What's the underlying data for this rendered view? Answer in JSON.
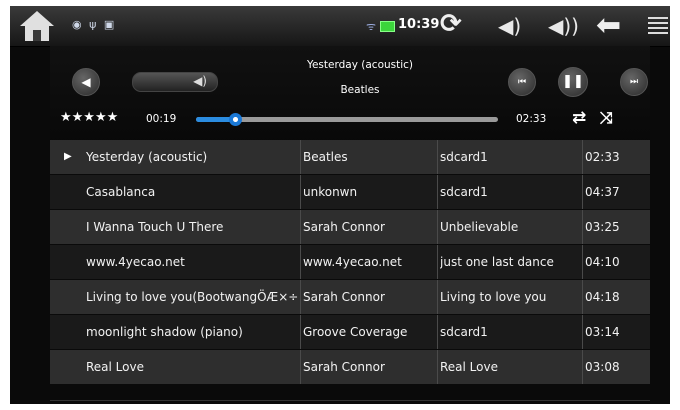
{
  "statusbar": {
    "home_icon": "home-icon",
    "notifications": "◉ ψ ▣",
    "time": "10:39",
    "icons": [
      "refresh-icon",
      "volume-down-icon",
      "volume-up-icon",
      "back-icon",
      "menu-icon"
    ]
  },
  "player": {
    "now_playing_title": "Yesterday (acoustic)",
    "now_playing_artist": "Beatles",
    "elapsed": "00:19",
    "total": "02:33",
    "progress_fraction": 0.13,
    "rating_stars": "★★★★★",
    "icons": [
      "back-arrow-icon",
      "volume-icon",
      "previous-track-icon",
      "pause-icon",
      "next-track-icon",
      "repeat-icon",
      "shuffle-icon"
    ]
  },
  "tracks": [
    {
      "title": "Yesterday (acoustic)",
      "artist": "Beatles",
      "album": "sdcard1",
      "duration": "02:33",
      "playing": true
    },
    {
      "title": "Casablanca",
      "artist": "unkonwn",
      "album": "sdcard1",
      "duration": "04:37",
      "playing": false
    },
    {
      "title": "I Wanna Touch U There",
      "artist": "Sarah Connor",
      "album": "Unbelievable",
      "duration": "03:25",
      "playing": false
    },
    {
      "title": "www.4yecao.net",
      "artist": "www.4yecao.net",
      "album": "just one last dance",
      "duration": "04:10",
      "playing": false
    },
    {
      "title": "Living to love you(BootwangÖÆ×÷)",
      "artist": "Sarah Connor",
      "album": "Living to love you",
      "duration": "04:18",
      "playing": false
    },
    {
      "title": "moonlight shadow (piano)",
      "artist": "Groove Coverage",
      "album": "sdcard1",
      "duration": "03:14",
      "playing": false
    },
    {
      "title": "Real Love",
      "artist": "Sarah Connor",
      "album": "Real Love",
      "duration": "03:08",
      "playing": false
    }
  ]
}
